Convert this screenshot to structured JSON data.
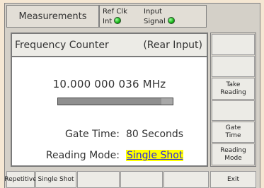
{
  "header": {
    "title": "Measurements",
    "ref_clk_label": "Ref Clk",
    "ref_clk_value": "Int",
    "input_label": "Input",
    "input_value": "Signal"
  },
  "panel": {
    "title": "Frequency Counter",
    "input_source": "(Rear Input)",
    "frequency": "10.000 000 036 MHz",
    "gate_time_label": "Gate Time:",
    "gate_time_value": "80 Seconds",
    "reading_mode_label": "Reading Mode:",
    "reading_mode_value": "Single Shot",
    "progress_fraction": 0.9
  },
  "softkeys": [
    "",
    "",
    "Take\nReading",
    "",
    "Gate\nTime",
    "Reading\nMode"
  ],
  "bottom_keys": [
    "Repetitive",
    "Single Shot",
    "",
    "",
    "",
    "Exit"
  ],
  "colors": {
    "led_green": "#14b414",
    "highlight_bg": "#ffff00",
    "highlight_text": "#2b2bdd"
  }
}
